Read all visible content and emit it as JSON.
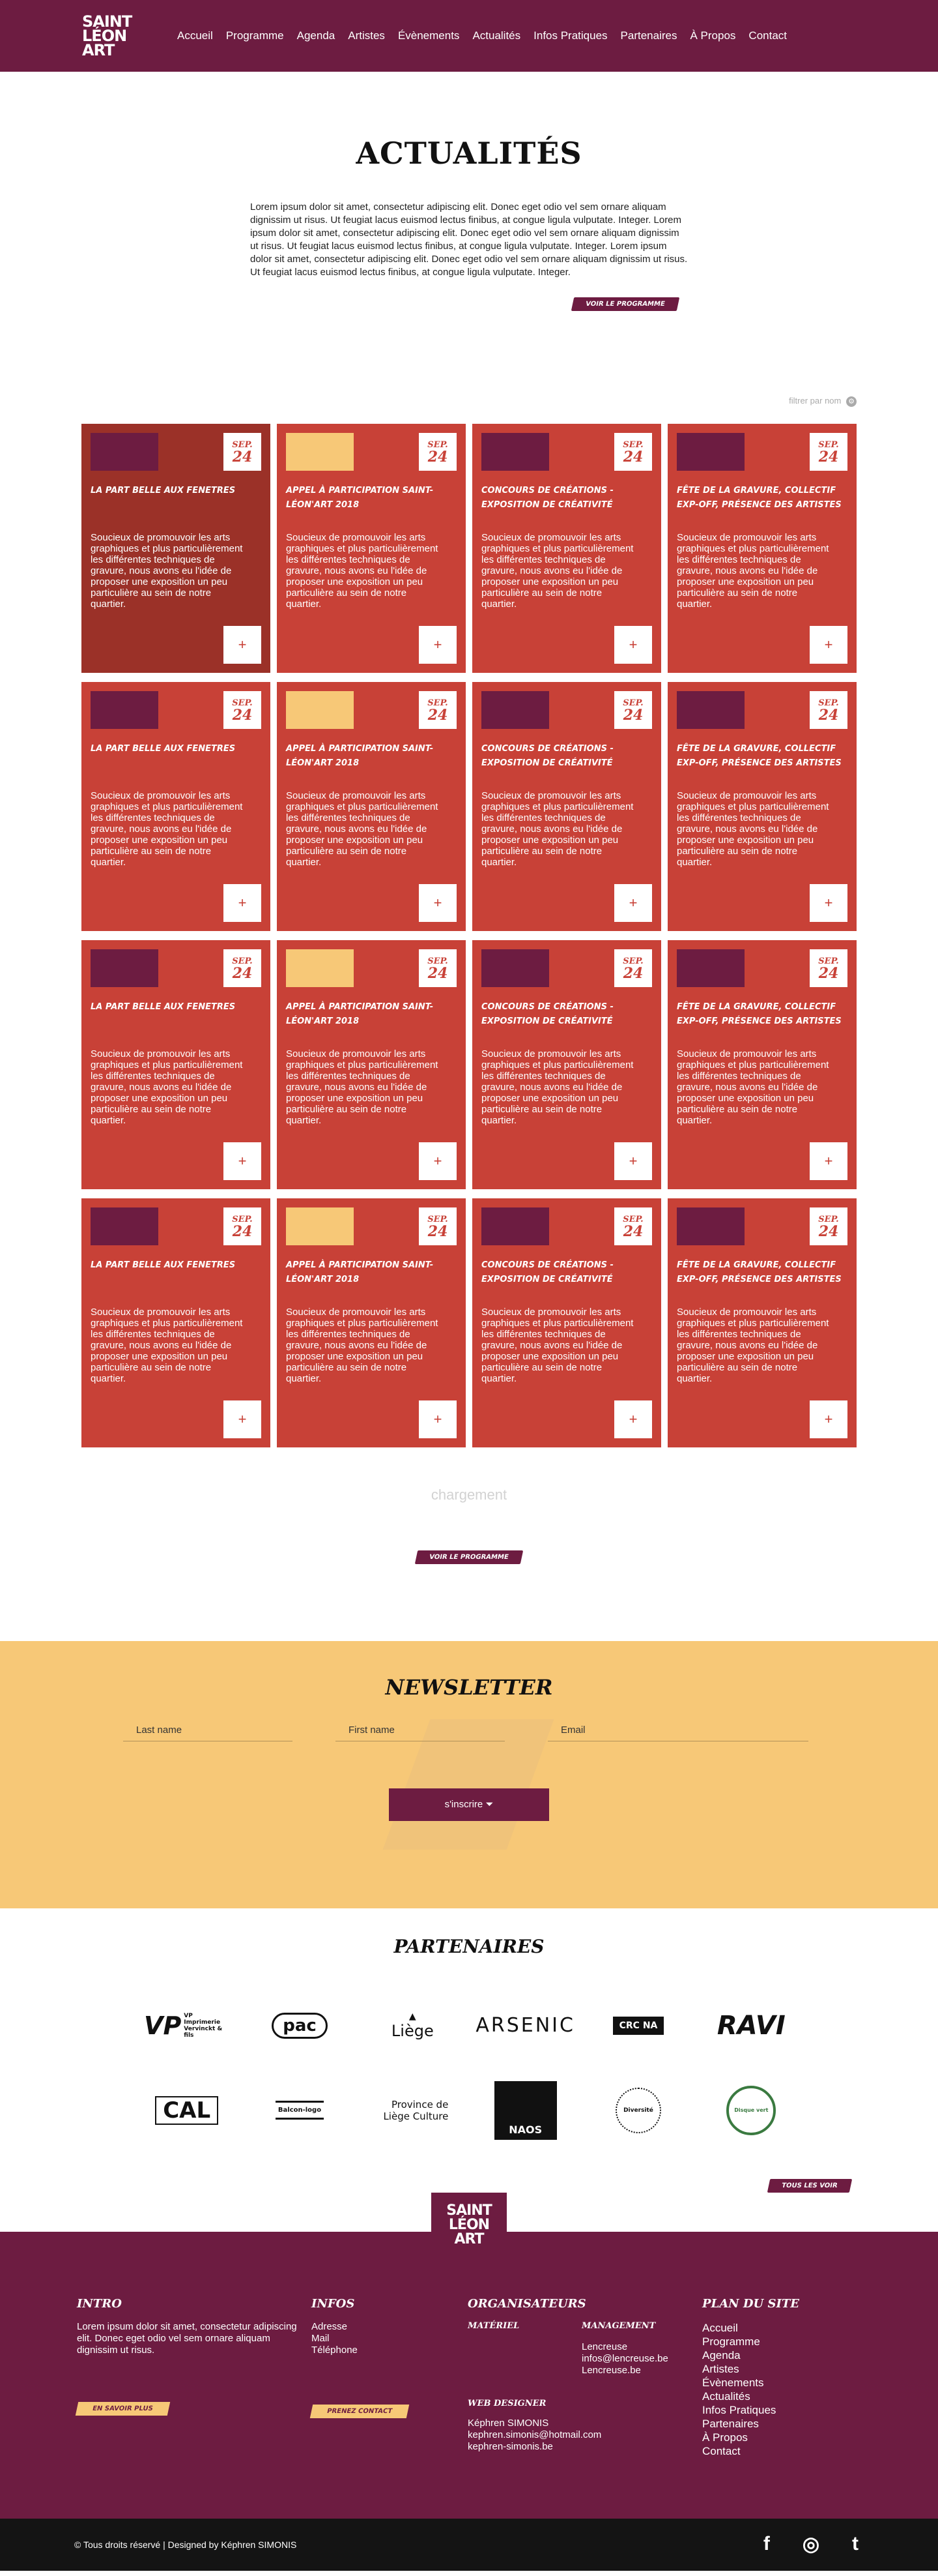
{
  "header": {
    "logo_lines": [
      "SAINT",
      "LÉON",
      "ART"
    ],
    "nav": [
      "Accueil",
      "Programme",
      "Agenda",
      "Artistes",
      "Évènements",
      "Actualités",
      "Infos Pratiques",
      "Partenaires",
      "À Propos",
      "Contact"
    ]
  },
  "intro": {
    "title": "ACTUALITÉS",
    "text": "Lorem ipsum dolor sit amet, consectetur adipiscing elit. Donec eget odio vel sem ornare aliquam dignissim ut risus. Ut feugiat lacus euismod lectus finibus, at congue ligula vulputate. Integer. Lorem ipsum dolor sit amet, consectetur adipiscing elit. Donec eget odio vel sem ornare aliquam dignissim ut risus. Ut feugiat lacus euismod lectus finibus, at congue ligula vulputate. Integer. Lorem ipsum dolor sit amet, consectetur adipiscing elit. Donec eget odio vel sem ornare aliquam dignissim ut risus. Ut feugiat lacus euismod lectus finibus, at congue ligula vulputate. Integer.",
    "button": "Voir le programme"
  },
  "filter": {
    "label": "filtrer par nom",
    "icon": "gear-icon"
  },
  "cards_template": [
    {
      "title": "La part belle aux fenetres",
      "img": "purple"
    },
    {
      "title": "Appel à participation Saint-Léon'Art 2018",
      "img": "gold"
    },
    {
      "title": "Concours de créations - exposition de créativité",
      "img": "purple"
    },
    {
      "title": "Fête de la gravure, collectif Exp-Off, présence des artistes",
      "img": "purple"
    }
  ],
  "card_common": {
    "date_month": "SEP.",
    "date_day": "24",
    "desc": "Soucieux de promouvoir les arts graphiques et plus particulièrement les différentes techniques de gravure, nous avons eu l'idée de proposer une exposition un peu particulière au sein de notre quartier.",
    "plus": "+"
  },
  "loading": "chargement",
  "program_button": "Voir le programme",
  "newsletter": {
    "title": "NEWSLETTER",
    "placeholders": [
      "Last name",
      "First name",
      "Email"
    ],
    "submit": "s'inscrire ⏷"
  },
  "partners": {
    "title": "PARTENAIRES",
    "logos": [
      "VP Imprimerie Vervinckt & fils",
      "pac",
      "Liège",
      "ARSENIC",
      "CRC NA",
      "RAVI",
      "CAL",
      "Balcon-logo",
      "Province de Liège Culture",
      "NAOS",
      "Diversité",
      "Disque vert"
    ],
    "all_button": "Tous les voir"
  },
  "footer": {
    "logo_lines": [
      "SAINT",
      "LÉON",
      "ART"
    ],
    "intro": {
      "title": "INTRO",
      "text": "Lorem ipsum dolor sit amet, consectetur adipiscing elit. Donec eget odio vel sem ornare aliquam dignissim ut risus.",
      "button": "En savoir plus"
    },
    "infos": {
      "title": "INFOS",
      "items": [
        "Adresse",
        "Mail",
        "Téléphone"
      ],
      "button": "Prenez contact"
    },
    "orga": {
      "title": "ORGANISATEURS",
      "materiel_title": "MATÉRIEL",
      "management_title": "MANAGEMENT",
      "management_items": [
        "Lencreuse",
        "infos@lencreuse.be",
        "Lencreuse.be"
      ],
      "webdesigner_title": "WEB DESIGNER",
      "webdesigner_items": [
        "Képhren SIMONIS",
        "kephren.simonis@hotmail.com",
        "kephren-simonis.be"
      ]
    },
    "plan": {
      "title": "PLAN DU SITE",
      "items": [
        "Accueil",
        "Programme",
        "Agenda",
        "Artistes",
        "Évènements",
        "Actualités",
        "Infos Pratiques",
        "Partenaires",
        "À Propos",
        "Contact"
      ]
    },
    "copyright": "© Tous droits réservé | Designed by Képhren SIMONIS",
    "socials": [
      "f",
      "◎",
      "t"
    ]
  }
}
